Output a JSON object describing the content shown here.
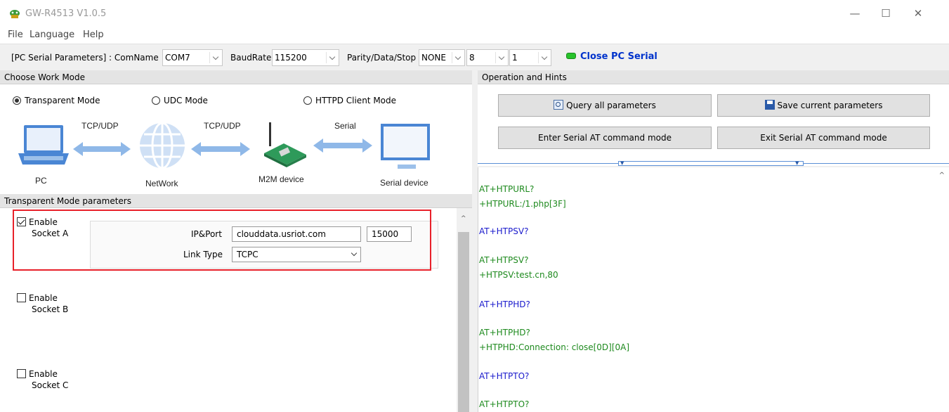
{
  "window": {
    "title": "GW-R4513 V1.0.5",
    "controls": [
      "—",
      "☐",
      "✕"
    ]
  },
  "menu": [
    "File",
    "Language",
    "Help"
  ],
  "serial": {
    "section_label": "[PC Serial Parameters] : ComName",
    "com_value": "COM7",
    "baud_label": "BaudRate",
    "baud_value": "115200",
    "parity_label": "Parity/Data/Stop",
    "parity_value": "NONE",
    "data_value": "8",
    "stop_value": "1",
    "close_button": "Close PC Serial",
    "status_color": "#27c22a"
  },
  "work_mode": {
    "header": "Choose Work Mode",
    "modes": [
      {
        "label": "Transparent Mode",
        "selected": true
      },
      {
        "label": "UDC Mode",
        "selected": false
      },
      {
        "label": "HTTPD Client Mode",
        "selected": false
      }
    ],
    "diagram": {
      "labels": [
        "TCP/UDP",
        "TCP/UDP",
        "Serial"
      ],
      "nodes": [
        "PC",
        "NetWork",
        "M2M device",
        "Serial device"
      ]
    }
  },
  "params": {
    "header": "Transparent Mode parameters",
    "socket_a": {
      "enable": "Enable",
      "name": "Socket A",
      "checked": true
    },
    "socket_b": {
      "enable": "Enable",
      "name": "Socket B",
      "checked": false
    },
    "socket_c": {
      "enable": "Enable",
      "name": "Socket C",
      "checked": false
    },
    "ip_port_label": "IP&Port",
    "ip_value": "clouddata.usriot.com",
    "port_value": "15000",
    "link_type_label": "Link Type",
    "link_type_value": "TCPC"
  },
  "operation": {
    "header": "Operation and Hints",
    "query_button": "Query all parameters",
    "save_button": "Save current parameters",
    "enter_at_button": "Enter Serial AT command mode",
    "exit_at_button": "Exit Serial AT command mode"
  },
  "console": [
    {
      "text": "AT+HTPURL?",
      "color": "green"
    },
    {
      "text": "+HTPURL:/1.php[3F]",
      "color": "green"
    },
    {
      "text": "AT+HTPSV?",
      "color": "blue"
    },
    {
      "text": "AT+HTPSV?",
      "color": "green"
    },
    {
      "text": "+HTPSV:test.cn,80",
      "color": "green"
    },
    {
      "text": "AT+HTPHD?",
      "color": "blue"
    },
    {
      "text": "AT+HTPHD?",
      "color": "green"
    },
    {
      "text": "+HTPHD:Connection: close[0D][0A]",
      "color": "green"
    },
    {
      "text": "AT+HTPTO?",
      "color": "blue"
    },
    {
      "text": "AT+HTPTO?",
      "color": "green"
    }
  ]
}
